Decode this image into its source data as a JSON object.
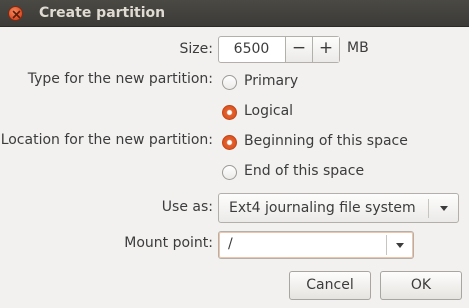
{
  "window": {
    "title": "Create partition"
  },
  "size": {
    "label": "Size:",
    "value": "6500",
    "decrement": "−",
    "increment": "+",
    "unit": "MB"
  },
  "type": {
    "label": "Type for the new partition:",
    "options": [
      {
        "label": "Primary",
        "checked": false
      },
      {
        "label": "Logical",
        "checked": true
      }
    ]
  },
  "location": {
    "label": "Location for the new partition:",
    "options": [
      {
        "label": "Beginning of this space",
        "checked": true
      },
      {
        "label": "End of this space",
        "checked": false
      }
    ]
  },
  "use_as": {
    "label": "Use as:",
    "value": "Ext4 journaling file system"
  },
  "mount_point": {
    "label": "Mount point:",
    "value": "/"
  },
  "buttons": {
    "cancel": "Cancel",
    "ok": "OK"
  },
  "colors": {
    "accent": "#dd4814",
    "titlebar": "#3c3b37",
    "background": "#f2f1f0"
  }
}
